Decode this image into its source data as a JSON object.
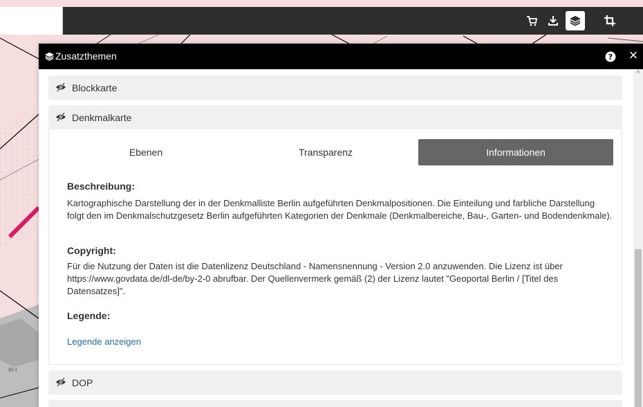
{
  "toolbar": {
    "buttons": [
      {
        "icon": "cart-icon",
        "active": false
      },
      {
        "icon": "download-icon",
        "active": false
      },
      {
        "icon": "layers-icon",
        "active": true
      },
      {
        "icon": "crop-icon",
        "active": false
      }
    ]
  },
  "map": {
    "label": "III-I"
  },
  "panel": {
    "title": "Zusatzthemen",
    "help_icon": "help-icon",
    "close_icon": "close-icon",
    "close_glyph": "×",
    "scroll_up_glyph": "^"
  },
  "accordion": [
    {
      "label": "Blockkarte",
      "expanded": false
    },
    {
      "label": "Denkmalkarte",
      "expanded": true
    },
    {
      "label": "DOP",
      "expanded": false
    }
  ],
  "tabs": [
    {
      "label": "Ebenen",
      "active": false
    },
    {
      "label": "Transparenz",
      "active": false
    },
    {
      "label": "Informationen",
      "active": true
    }
  ],
  "info": {
    "beschreibung_heading": "Beschreibung:",
    "beschreibung_text": "Kartographische Darstellung der in der Denkmalliste Berlin aufgeführten Denkmalpositionen. Die Einteilung und farbliche Darstellung folgt den im Denkmalschutzgesetz Berlin aufgeführten Kategorien der Denkmale (Denkmalbereiche, Bau-, Garten- und Bodendenkmale).",
    "copyright_heading": "Copyright:",
    "copyright_text": "Für die Nutzung der Daten ist die Datenlizenz Deutschland - Namensnennung - Version 2.0 anzuwenden. Die Lizenz ist über https://www.govdata.de/dl-de/by-2-0 abrufbar. Der Quellenvermerk gemäß (2) der Lizenz lautet \"Geoportal Berlin / [Titel des Datensatzes]\".",
    "legende_heading": "Legende:",
    "legende_link": "Legende anzeigen"
  },
  "colors": {
    "map_bg": "#f7dede",
    "toolbar_bg": "#2e2e2e",
    "panel_header_bg": "#000000",
    "active_tab_bg": "#666666",
    "link": "#1e6fb8"
  }
}
